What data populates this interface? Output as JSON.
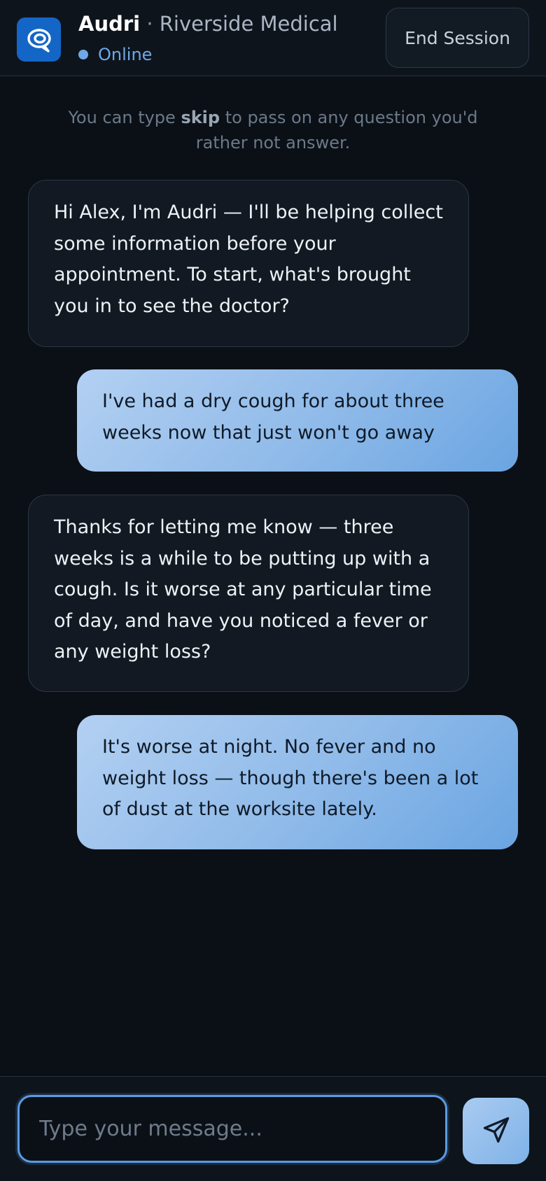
{
  "header": {
    "assistant_name": "Audri",
    "separator": "·",
    "organization": "Riverside Medical",
    "status": "Online",
    "end_session_label": "End Session",
    "logo_icon": "chat-bubble-icon",
    "accent_color": "#1466c6",
    "status_color": "#6ea8e8"
  },
  "hint": {
    "before": "You can type ",
    "keyword": "skip",
    "after": " to pass on any question you'd rather not answer."
  },
  "messages": [
    {
      "sender": "bot",
      "text": "Hi Alex, I'm Audri — I'll be helping collect some information before your appointment. To start, what's brought you in to see the doctor?"
    },
    {
      "sender": "user",
      "text": "I've had a dry cough for about three weeks now that just won't go away"
    },
    {
      "sender": "bot",
      "text": "Thanks for letting me know — three weeks is a while to be putting up with a cough. Is it worse at any particular time of day, and have you noticed a fever or any weight loss?"
    },
    {
      "sender": "user",
      "text": "It's worse at night. No fever and no weight loss — though there's been a lot of dust at the worksite lately."
    }
  ],
  "composer": {
    "placeholder": "Type your message...",
    "value": "",
    "send_icon": "send-icon"
  }
}
